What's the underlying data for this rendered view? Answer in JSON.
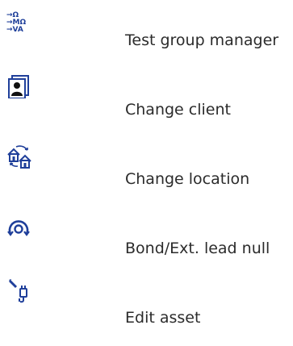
{
  "menu": {
    "items": [
      {
        "label": "Test group manager",
        "icon": "test-group-manager-icon",
        "icon_lines": [
          "→Ω",
          "→MΩ",
          "→VA"
        ]
      },
      {
        "label": "Change client",
        "icon": "client-card-icon"
      },
      {
        "label": "Change location",
        "icon": "change-location-icon"
      },
      {
        "label": "Bond/Ext. lead null",
        "icon": "bond-null-icon"
      },
      {
        "label": "Edit asset",
        "icon": "edit-asset-icon"
      }
    ]
  },
  "colors": {
    "icon": "#1f3f9a",
    "text": "#2b2b2b",
    "background": "#ffffff"
  }
}
